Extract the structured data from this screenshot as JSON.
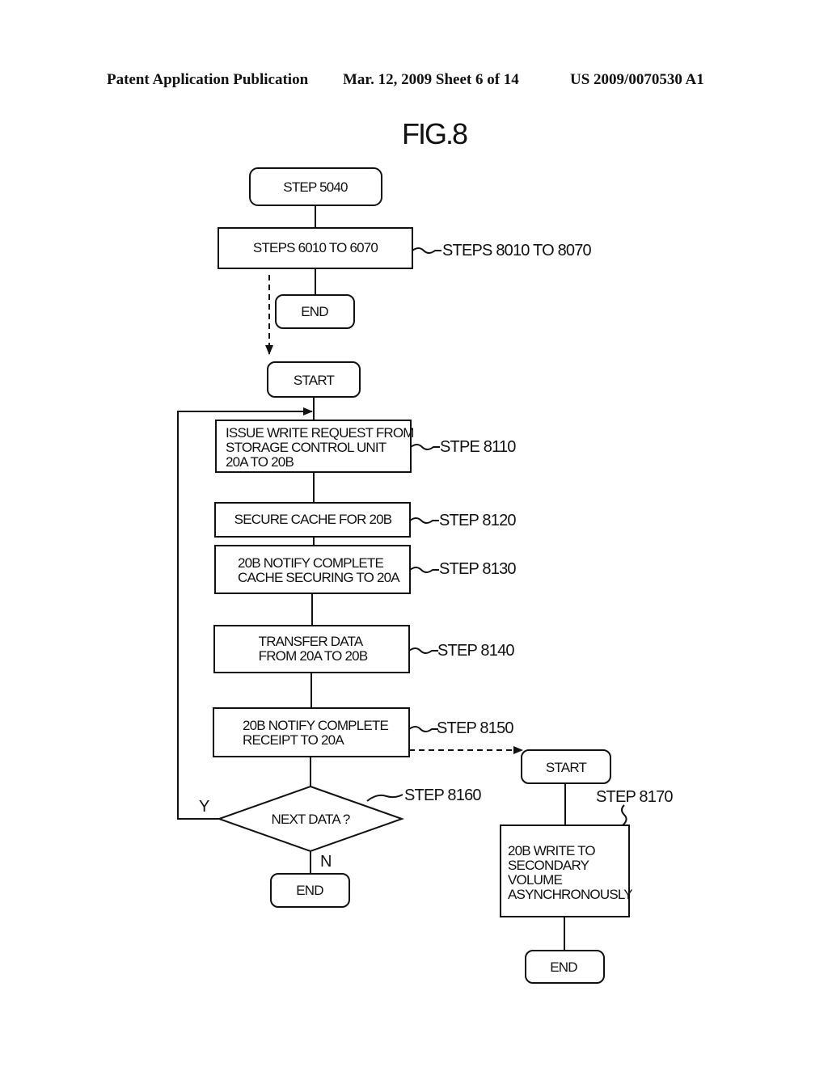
{
  "header": {
    "left": "Patent Application Publication",
    "middle": "Mar. 12, 2009  Sheet 6 of 14",
    "right": "US 2009/0070530 A1"
  },
  "figure": {
    "title": "FIG.8",
    "nodes": {
      "step5040": "STEP 5040",
      "steps6010": "STEPS 6010 TO 6070",
      "end1": "END",
      "start1": "START",
      "issue": [
        "ISSUE WRITE REQUEST FROM",
        "STORAGE CONTROL UNIT",
        "20A TO 20B"
      ],
      "secure": "SECURE CACHE FOR 20B",
      "notify_cache": [
        "20B NOTIFY COMPLETE",
        "CACHE SECURING TO 20A"
      ],
      "transfer": [
        "TRANSFER DATA",
        "FROM 20A TO 20B"
      ],
      "notify_receipt": [
        "20B NOTIFY COMPLETE",
        "RECEIPT TO 20A"
      ],
      "decision": "NEXT DATA ?",
      "end2": "END",
      "start2": "START",
      "write_secondary": [
        "20B WRITE TO",
        "SECONDARY",
        "VOLUME",
        "ASYNCHRONOUSLY"
      ],
      "end3": "END"
    },
    "labels": {
      "steps8010": "STEPS 8010 TO 8070",
      "s8110": "STPE 8110",
      "s8120": "STEP 8120",
      "s8130": "STEP 8130",
      "s8140": "STEP 8140",
      "s8150": "STEP 8150",
      "s8160": "STEP 8160",
      "s8170": "STEP 8170",
      "yes": "Y",
      "no": "N"
    }
  }
}
